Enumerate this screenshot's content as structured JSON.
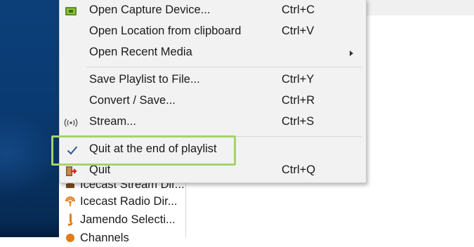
{
  "menu": {
    "items": [
      {
        "label": "Open Capture Device...",
        "shortcut": "Ctrl+C",
        "icon": "capture-device-icon"
      },
      {
        "label": "Open Location from clipboard",
        "shortcut": "Ctrl+V",
        "icon": ""
      },
      {
        "label": "Open Recent Media",
        "shortcut": "",
        "icon": "",
        "submenu": true
      },
      {
        "label": "Save Playlist to File...",
        "shortcut": "Ctrl+Y",
        "icon": ""
      },
      {
        "label": "Convert / Save...",
        "shortcut": "Ctrl+R",
        "icon": ""
      },
      {
        "label": "Stream...",
        "shortcut": "Ctrl+S",
        "icon": "stream-icon"
      },
      {
        "label": "Quit at the end of playlist",
        "shortcut": "",
        "icon": "checkmark-icon",
        "checked": true
      },
      {
        "label": "Quit",
        "shortcut": "Ctrl+Q",
        "icon": "quit-icon"
      }
    ]
  },
  "side_list": {
    "items": [
      {
        "label": "Icecast Stream Dir...",
        "icon": "icecast-stream-icon"
      },
      {
        "label": "Icecast Radio Dir...",
        "icon": "radio-icon"
      },
      {
        "label": "Jamendo Selecti...",
        "icon": "jamendo-icon"
      },
      {
        "label": "Channels",
        "icon": "channels-icon"
      }
    ]
  },
  "colors": {
    "highlight_border": "#a7d26e",
    "checkmark": "#2b579a",
    "desktop": "#0a3a72",
    "menu_background": "#f2f2f2"
  }
}
